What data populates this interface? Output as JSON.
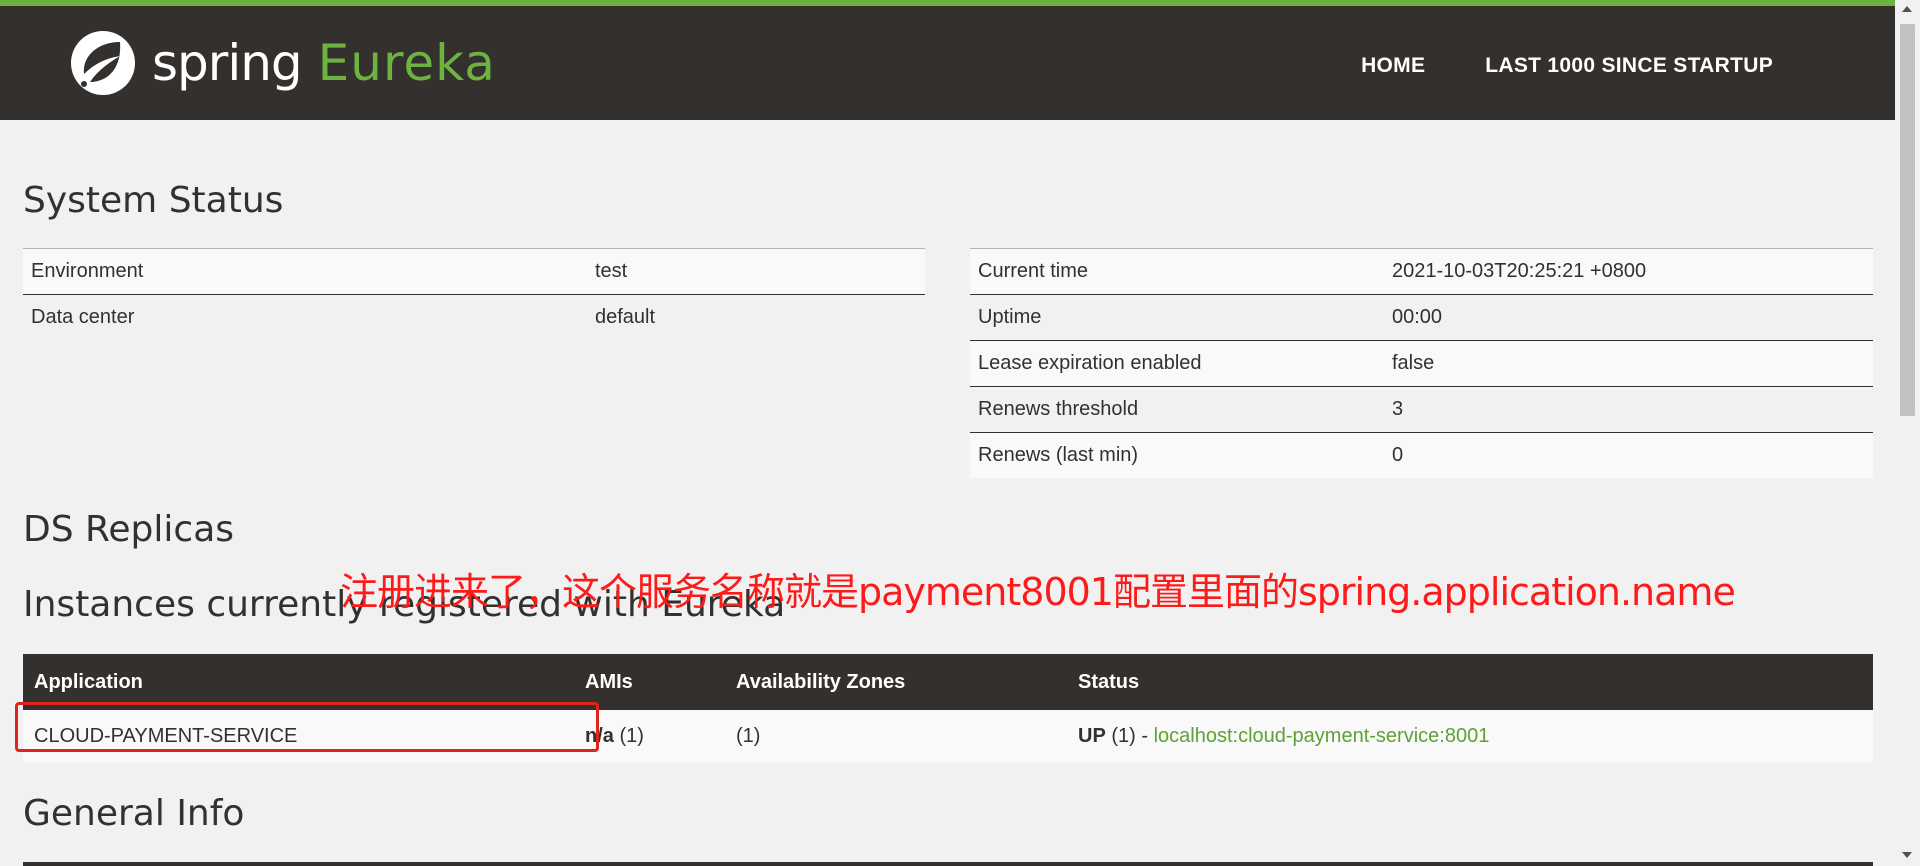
{
  "header": {
    "logo_spring": "spring",
    "logo_eureka": "Eureka",
    "nav": [
      {
        "label": "HOME"
      },
      {
        "label": "LAST 1000 SINCE STARTUP"
      }
    ]
  },
  "system_status": {
    "title": "System Status",
    "left": [
      {
        "key": "Environment",
        "value": "test"
      },
      {
        "key": "Data center",
        "value": "default"
      }
    ],
    "right": [
      {
        "key": "Current time",
        "value": "2021-10-03T20:25:21 +0800"
      },
      {
        "key": "Uptime",
        "value": "00:00"
      },
      {
        "key": "Lease expiration enabled",
        "value": "false"
      },
      {
        "key": "Renews threshold",
        "value": "3"
      },
      {
        "key": "Renews (last min)",
        "value": "0"
      }
    ]
  },
  "ds_replicas": {
    "title": "DS Replicas"
  },
  "instances": {
    "title": "Instances currently registered with Eureka",
    "headers": [
      "Application",
      "AMIs",
      "Availability Zones",
      "Status"
    ],
    "rows": [
      {
        "application": "CLOUD-PAYMENT-SERVICE",
        "amis_bold": "n/a",
        "amis_count": " (1)",
        "zones": "(1)",
        "status_bold": "UP",
        "status_text": " (1) - ",
        "status_link": "localhost:cloud-payment-service:8001"
      }
    ]
  },
  "general_info": {
    "title": "General Info"
  },
  "annotation": {
    "text": "注册进来了，这个服务名称就是payment8001配置里面的spring.application.name"
  },
  "colors": {
    "header_bg": "#34302d",
    "accent_green": "#6db33f",
    "annotation_red": "#ff1a1a"
  }
}
